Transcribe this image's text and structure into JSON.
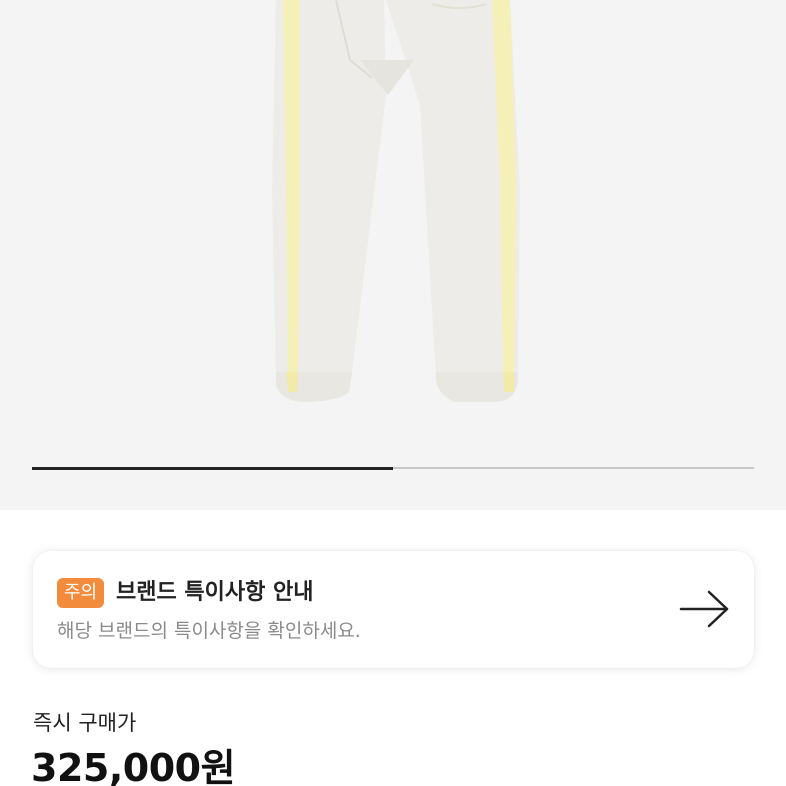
{
  "gallery": {
    "image_alt": "product-image-track-pants",
    "slide_progress": 0.5
  },
  "notice": {
    "badge": "주의",
    "title": "브랜드 특이사항 안내",
    "description": "해당 브랜드의 특이사항을 확인하세요.",
    "icon": "arrow-right-icon",
    "badge_color": "#f28c3c"
  },
  "price": {
    "label": "즉시 구매가",
    "value": "325,000원"
  }
}
